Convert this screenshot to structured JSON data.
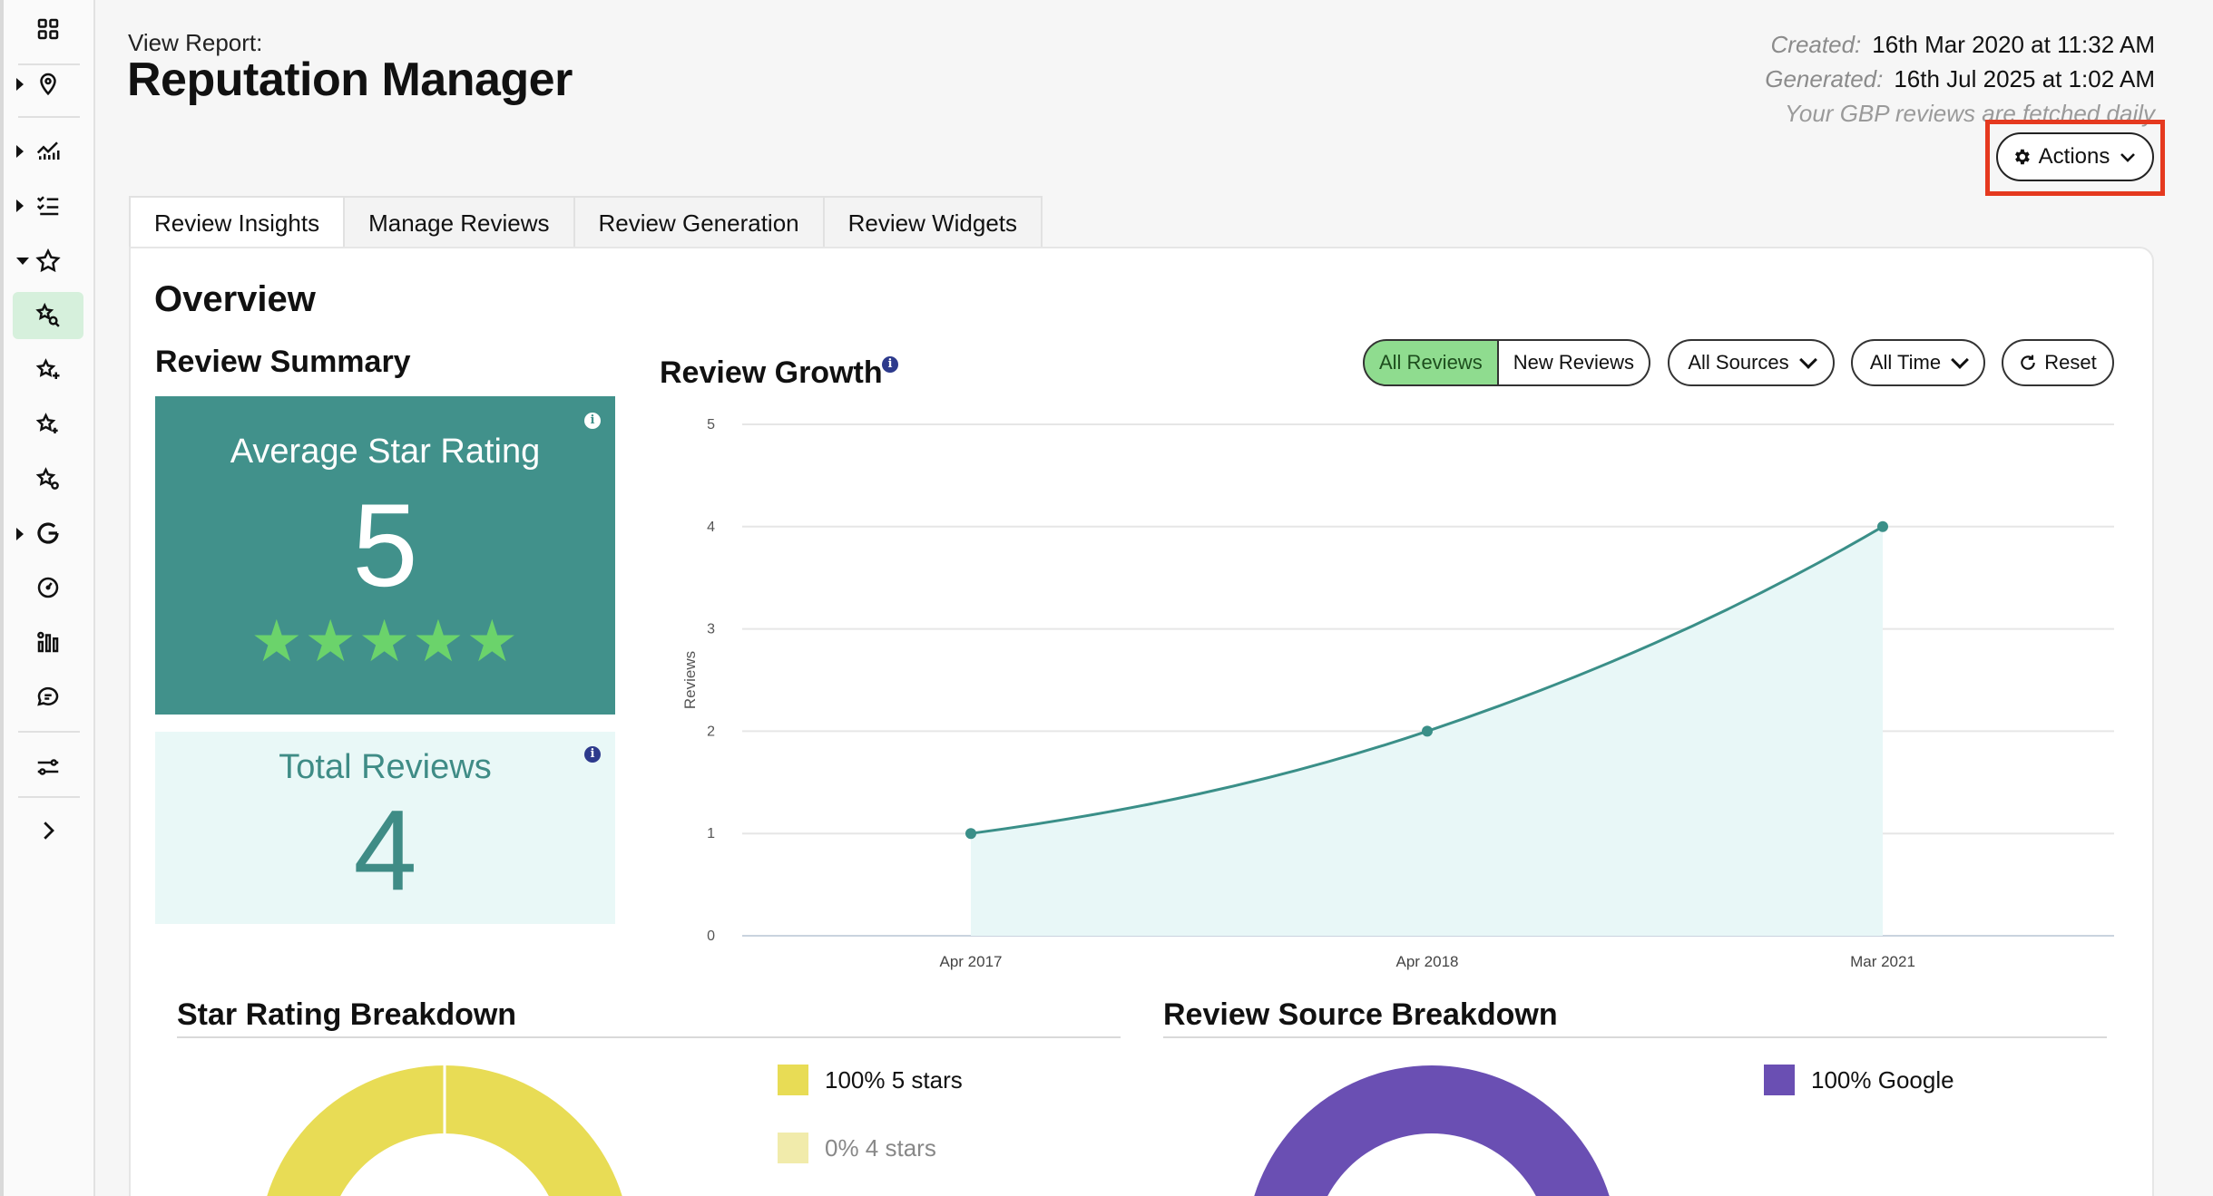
{
  "sidebar": {
    "items": [
      {
        "icon": "grid-icon"
      },
      {
        "icon": "location-pin-icon",
        "caret": "right"
      },
      {
        "icon": "analytics-icon",
        "caret": "right"
      },
      {
        "icon": "checklist-icon",
        "caret": "right"
      },
      {
        "icon": "star-icon",
        "caret": "down"
      },
      {
        "icon": "star-search-icon",
        "active": true
      },
      {
        "icon": "star-sparkle-icon"
      },
      {
        "icon": "star-plus-icon"
      },
      {
        "icon": "star-gear-icon"
      },
      {
        "icon": "google-icon",
        "caret": "right"
      },
      {
        "icon": "gauge-icon"
      },
      {
        "icon": "bar-chart-icon"
      },
      {
        "icon": "chat-bubble-icon"
      },
      {
        "icon": "sliders-icon"
      },
      {
        "icon": "chevron-right-icon"
      }
    ]
  },
  "header": {
    "view_label": "View Report:",
    "title": "Reputation Manager",
    "created_label": "Created:",
    "created_value": "16th Mar 2020 at 11:32 AM",
    "generated_label": "Generated:",
    "generated_value": "16th Jul 2025 at 1:02 AM",
    "note": "Your GBP reviews are fetched daily",
    "actions_label": "Actions"
  },
  "tabs": [
    {
      "label": "Review Insights",
      "active": true
    },
    {
      "label": "Manage Reviews"
    },
    {
      "label": "Review Generation"
    },
    {
      "label": "Review Widgets"
    }
  ],
  "overview": {
    "title": "Overview",
    "summary_title": "Review Summary",
    "avg_label": "Average Star Rating",
    "avg_value": "5",
    "stars": "★★★★★",
    "total_label": "Total Reviews",
    "total_value": "4"
  },
  "growth": {
    "title": "Review Growth",
    "filters": {
      "all_reviews": "All Reviews",
      "new_reviews": "New Reviews",
      "sources": "All Sources",
      "time": "All Time",
      "reset": "Reset"
    }
  },
  "chart_data": {
    "type": "area",
    "x": [
      "Apr 2017",
      "Apr 2018",
      "Mar 2021"
    ],
    "values": [
      1,
      2,
      4
    ],
    "ylabel": "Reviews",
    "ylim": [
      0,
      5
    ],
    "yticks": [
      "0",
      "1",
      "2",
      "3",
      "4",
      "5"
    ],
    "grid": true,
    "colors": {
      "line": "#3a8f88",
      "fill": "#e8f7f7"
    }
  },
  "star_breakdown": {
    "title": "Star Rating Breakdown",
    "legend": [
      {
        "label": "100% 5 stars",
        "color": "#e8dc55"
      },
      {
        "label": "0% 4 stars",
        "color": "#f1ebab"
      }
    ]
  },
  "source_breakdown": {
    "title": "Review Source Breakdown",
    "legend": [
      {
        "label": "100% Google",
        "color": "#6a4fb3"
      }
    ]
  },
  "colors": {
    "accent_teal": "#41918b",
    "accent_green": "#8fdc8f",
    "highlight_red": "#e5391f",
    "google_purple": "#6a4fb3",
    "star_yellow": "#e8dc55"
  }
}
